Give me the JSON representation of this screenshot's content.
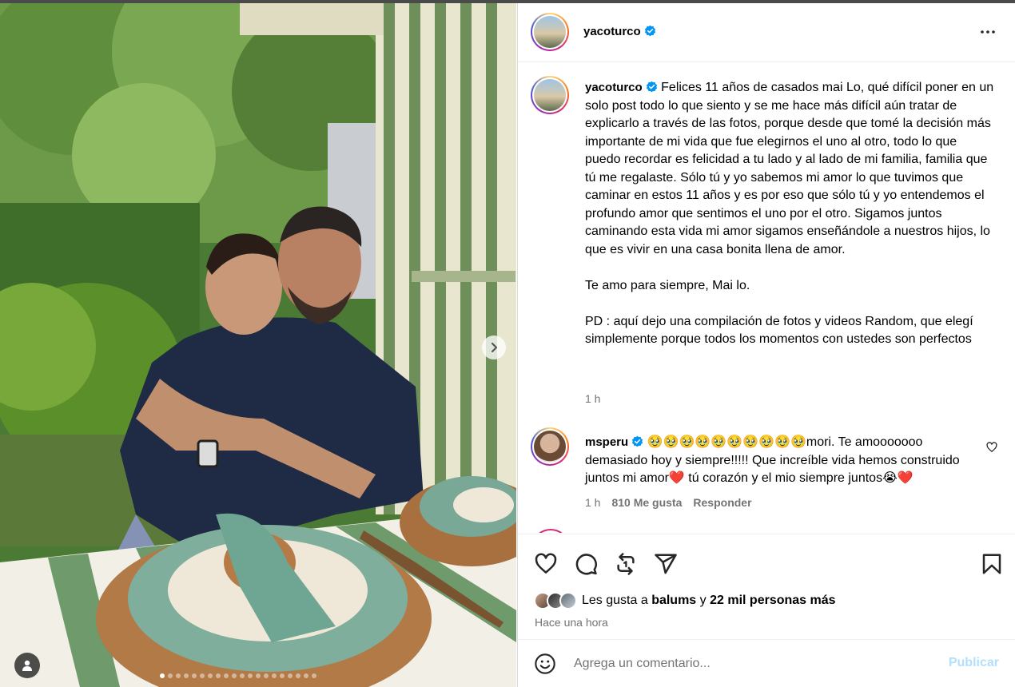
{
  "post": {
    "author": "yacoturco",
    "verified": true,
    "caption_paragraphs": [
      "Felices 11 años de casados mai Lo, qué difícil poner en un solo post todo lo que siento y se me hace más difícil aún tratar de explicarlo a través de las fotos, porque desde que tomé la decisión más importante de mi vida que fue elegirnos el uno al otro, todo lo que puedo recordar es felicidad a tu lado y al lado de mi familia, familia que tú me regalaste. Sólo tú y yo sabemos mi amor lo que tuvimos que caminar en estos 11 años y es por eso que sólo tú y yo entendemos el profundo amor que sentimos el uno por el otro. Sigamos juntos caminando esta vida mi amor sigamos enseñándole a nuestros hijos, lo que es vivir en una casa bonita llena de amor.",
      "Te amo para siempre, Mai lo.",
      "PD : aquí dejo una compilación de fotos y videos Random, que elegí simplemente porque todos los momentos con ustedes son perfectos"
    ],
    "caption_time": "1 h",
    "carousel_count": 20,
    "carousel_active_index": 0
  },
  "comment": {
    "author": "msperu",
    "verified": true,
    "text": "🥹🥹🥹🥹🥹🥹🥹🥹🥹🥹mori. Te amooooooo demasiado hoy y siempre!!!!! Que increíble vida hemos construido juntos mi amor❤️ tú corazón y el mio siempre juntos😭❤️",
    "time": "1 h",
    "likes": "810 Me gusta",
    "reply_label": "Responder"
  },
  "likes": {
    "prefix": "Les gusta a",
    "user": "balums",
    "conj": "y",
    "others": "22 mil personas más"
  },
  "post_time": "Hace una hora",
  "add_comment": {
    "placeholder": "Agrega un comentario...",
    "publish_label": "Publicar"
  },
  "colors": {
    "verified": "#0095f6",
    "publish_disabled": "#b2dffc",
    "secondary_text": "#737373"
  },
  "icons": {
    "more": "more-horizontal-icon",
    "like": "heart-icon",
    "comment": "comment-icon",
    "repost": "repost-icon",
    "share": "share-icon",
    "save": "bookmark-icon",
    "emoji": "emoji-icon",
    "next": "chevron-right-icon",
    "tag": "user-tag-icon"
  }
}
